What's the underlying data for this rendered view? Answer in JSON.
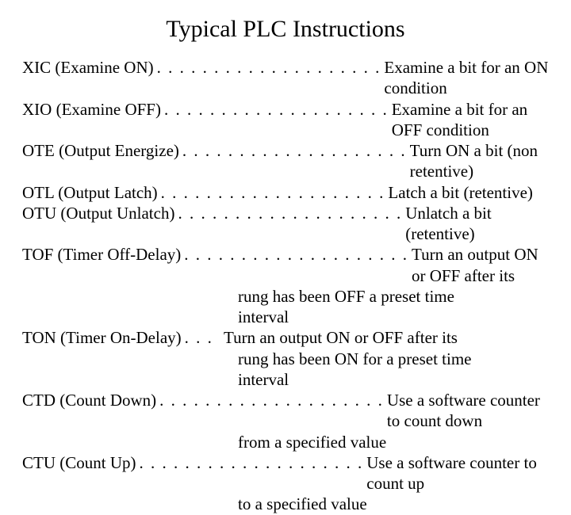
{
  "title": "Typical PLC Instructions",
  "rows": [
    {
      "term": "XIC (Examine ON)",
      "desc": "Examine a bit for an ON condition"
    },
    {
      "term": "XIO (Examine OFF)",
      "desc": "Examine a bit for an OFF condition"
    },
    {
      "term": "OTE (Output Energize)",
      "desc": "Turn ON a bit (non retentive)"
    },
    {
      "term": "OTL (Output Latch)",
      "desc": "Latch a bit (retentive)"
    },
    {
      "term": "OTU (Output Unlatch)",
      "desc": "Unlatch a bit (retentive)"
    },
    {
      "term": "TOF (Timer Off-Delay)",
      "desc": "Turn an output ON or OFF after its"
    },
    {
      "term": "",
      "desc": "rung has been OFF a preset time",
      "cont": true
    },
    {
      "term": "",
      "desc": "interval",
      "cont": true
    },
    {
      "term": "TON (Timer On-Delay)",
      "desc": "Turn an output ON or OFF after its",
      "short": true
    },
    {
      "term": "",
      "desc": "rung has been ON for a preset time",
      "cont": true
    },
    {
      "term": "",
      "desc": "interval",
      "cont": true
    },
    {
      "term": "CTD (Count Down)",
      "desc": "Use a software counter to count down"
    },
    {
      "term": "",
      "desc": "from a specified value",
      "cont": true
    },
    {
      "term": "CTU (Count Up)",
      "desc": "Use a software counter to count up"
    },
    {
      "term": "",
      "desc": "to a specified value",
      "cont": true
    }
  ]
}
